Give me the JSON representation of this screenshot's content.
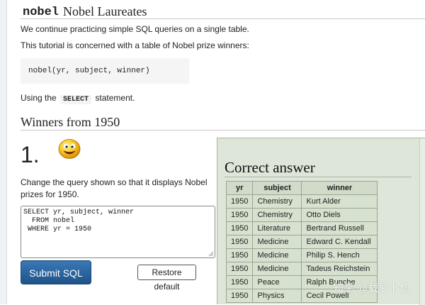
{
  "header": {
    "code": "nobel",
    "title": "Nobel Laureates"
  },
  "intro": {
    "p1": "We continue practicing simple SQL queries on a single table.",
    "p2": "This tutorial is concerned with a table of Nobel prize winners:",
    "schema": "nobel(yr, subject, winner)",
    "p3_before": "Using the",
    "p3_keyword": "SELECT",
    "p3_after": "statement."
  },
  "section": {
    "title": "Winners from 1950"
  },
  "question": {
    "number": "1.",
    "instruction": "Change the query shown so that it displays Nobel prizes for 1950.",
    "sql": "SELECT yr, subject, winner\n  FROM nobel\n WHERE yr = 1950",
    "submit_label": "Submit SQL",
    "restore_label": "Restore default",
    "smiley_icon": "smiley-face-icon"
  },
  "answer": {
    "title": "Correct answer",
    "columns": [
      "yr",
      "subject",
      "winner"
    ],
    "rows": [
      [
        "1950",
        "Chemistry",
        "Kurt Alder"
      ],
      [
        "1950",
        "Chemistry",
        "Otto Diels"
      ],
      [
        "1950",
        "Literature",
        "Bertrand Russell"
      ],
      [
        "1950",
        "Medicine",
        "Edward C. Kendall"
      ],
      [
        "1950",
        "Medicine",
        "Philip S. Hench"
      ],
      [
        "1950",
        "Medicine",
        "Tadeus Reichstein"
      ],
      [
        "1950",
        "Peace",
        "Ralph Bunche"
      ],
      [
        "1950",
        "Physics",
        "Cecil Powell"
      ]
    ]
  },
  "watermark": "知乎 @载萝卜鱼",
  "colors": {
    "submit_bg": "#2a6aa8",
    "answer_bg": "#dde6d9",
    "header_bg": "#d0dbc9"
  }
}
